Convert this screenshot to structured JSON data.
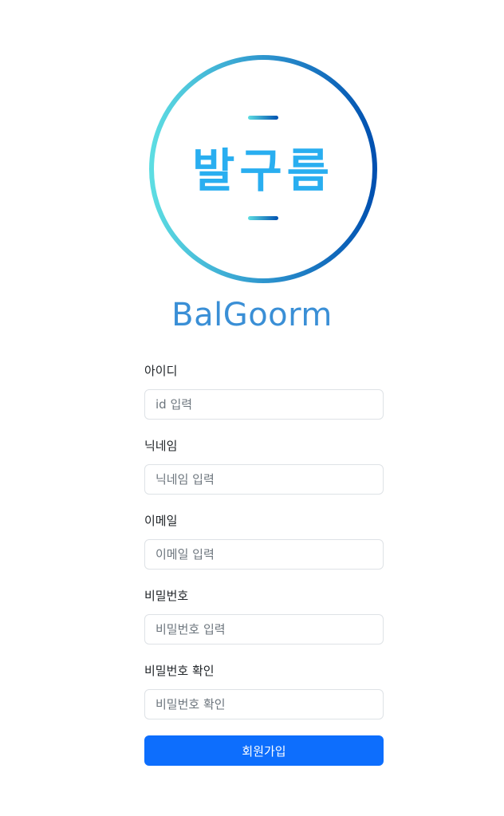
{
  "logo": {
    "text": "발구름"
  },
  "brand": {
    "name": "BalGoorm"
  },
  "form": {
    "fields": [
      {
        "label": "아이디",
        "placeholder": "id 입력",
        "type": "text"
      },
      {
        "label": "닉네임",
        "placeholder": "닉네임 입력",
        "type": "text"
      },
      {
        "label": "이메일",
        "placeholder": "이메일 입력",
        "type": "email"
      },
      {
        "label": "비밀번호",
        "placeholder": "비밀번호 입력",
        "type": "password"
      },
      {
        "label": "비밀번호 확인",
        "placeholder": "비밀번호 확인",
        "type": "password"
      }
    ],
    "submit_label": "회원가입"
  },
  "colors": {
    "brand_text": "#3a8fd6",
    "logo_text": "#29aef0",
    "ring_start": "#5ddde2",
    "ring_end": "#0050b0",
    "primary_button": "#0d6efd"
  }
}
